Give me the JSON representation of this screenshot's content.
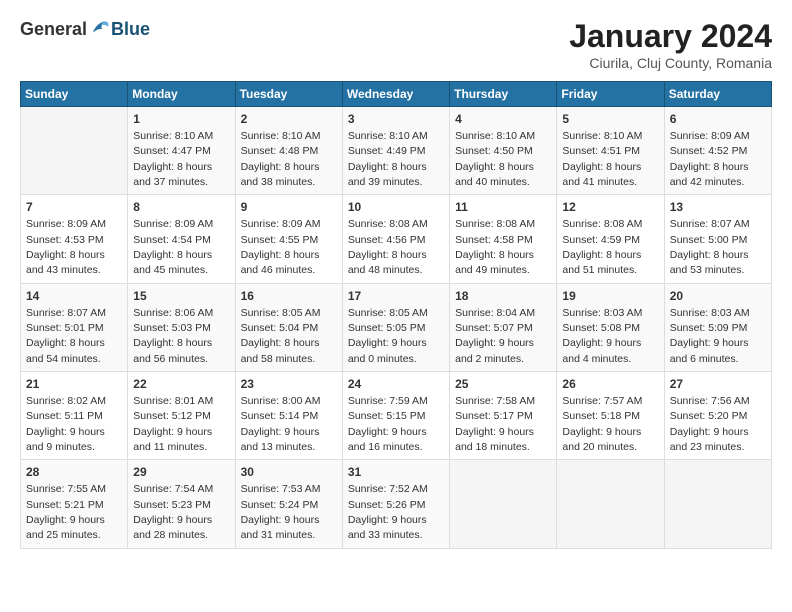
{
  "header": {
    "logo": {
      "general": "General",
      "blue": "Blue"
    },
    "title": "January 2024",
    "subtitle": "Ciurila, Cluj County, Romania"
  },
  "days_of_week": [
    "Sunday",
    "Monday",
    "Tuesday",
    "Wednesday",
    "Thursday",
    "Friday",
    "Saturday"
  ],
  "weeks": [
    [
      {
        "day": "",
        "info": ""
      },
      {
        "day": "1",
        "info": "Sunrise: 8:10 AM\nSunset: 4:47 PM\nDaylight: 8 hours\nand 37 minutes."
      },
      {
        "day": "2",
        "info": "Sunrise: 8:10 AM\nSunset: 4:48 PM\nDaylight: 8 hours\nand 38 minutes."
      },
      {
        "day": "3",
        "info": "Sunrise: 8:10 AM\nSunset: 4:49 PM\nDaylight: 8 hours\nand 39 minutes."
      },
      {
        "day": "4",
        "info": "Sunrise: 8:10 AM\nSunset: 4:50 PM\nDaylight: 8 hours\nand 40 minutes."
      },
      {
        "day": "5",
        "info": "Sunrise: 8:10 AM\nSunset: 4:51 PM\nDaylight: 8 hours\nand 41 minutes."
      },
      {
        "day": "6",
        "info": "Sunrise: 8:09 AM\nSunset: 4:52 PM\nDaylight: 8 hours\nand 42 minutes."
      }
    ],
    [
      {
        "day": "7",
        "info": "Sunrise: 8:09 AM\nSunset: 4:53 PM\nDaylight: 8 hours\nand 43 minutes."
      },
      {
        "day": "8",
        "info": "Sunrise: 8:09 AM\nSunset: 4:54 PM\nDaylight: 8 hours\nand 45 minutes."
      },
      {
        "day": "9",
        "info": "Sunrise: 8:09 AM\nSunset: 4:55 PM\nDaylight: 8 hours\nand 46 minutes."
      },
      {
        "day": "10",
        "info": "Sunrise: 8:08 AM\nSunset: 4:56 PM\nDaylight: 8 hours\nand 48 minutes."
      },
      {
        "day": "11",
        "info": "Sunrise: 8:08 AM\nSunset: 4:58 PM\nDaylight: 8 hours\nand 49 minutes."
      },
      {
        "day": "12",
        "info": "Sunrise: 8:08 AM\nSunset: 4:59 PM\nDaylight: 8 hours\nand 51 minutes."
      },
      {
        "day": "13",
        "info": "Sunrise: 8:07 AM\nSunset: 5:00 PM\nDaylight: 8 hours\nand 53 minutes."
      }
    ],
    [
      {
        "day": "14",
        "info": "Sunrise: 8:07 AM\nSunset: 5:01 PM\nDaylight: 8 hours\nand 54 minutes."
      },
      {
        "day": "15",
        "info": "Sunrise: 8:06 AM\nSunset: 5:03 PM\nDaylight: 8 hours\nand 56 minutes."
      },
      {
        "day": "16",
        "info": "Sunrise: 8:05 AM\nSunset: 5:04 PM\nDaylight: 8 hours\nand 58 minutes."
      },
      {
        "day": "17",
        "info": "Sunrise: 8:05 AM\nSunset: 5:05 PM\nDaylight: 9 hours\nand 0 minutes."
      },
      {
        "day": "18",
        "info": "Sunrise: 8:04 AM\nSunset: 5:07 PM\nDaylight: 9 hours\nand 2 minutes."
      },
      {
        "day": "19",
        "info": "Sunrise: 8:03 AM\nSunset: 5:08 PM\nDaylight: 9 hours\nand 4 minutes."
      },
      {
        "day": "20",
        "info": "Sunrise: 8:03 AM\nSunset: 5:09 PM\nDaylight: 9 hours\nand 6 minutes."
      }
    ],
    [
      {
        "day": "21",
        "info": "Sunrise: 8:02 AM\nSunset: 5:11 PM\nDaylight: 9 hours\nand 9 minutes."
      },
      {
        "day": "22",
        "info": "Sunrise: 8:01 AM\nSunset: 5:12 PM\nDaylight: 9 hours\nand 11 minutes."
      },
      {
        "day": "23",
        "info": "Sunrise: 8:00 AM\nSunset: 5:14 PM\nDaylight: 9 hours\nand 13 minutes."
      },
      {
        "day": "24",
        "info": "Sunrise: 7:59 AM\nSunset: 5:15 PM\nDaylight: 9 hours\nand 16 minutes."
      },
      {
        "day": "25",
        "info": "Sunrise: 7:58 AM\nSunset: 5:17 PM\nDaylight: 9 hours\nand 18 minutes."
      },
      {
        "day": "26",
        "info": "Sunrise: 7:57 AM\nSunset: 5:18 PM\nDaylight: 9 hours\nand 20 minutes."
      },
      {
        "day": "27",
        "info": "Sunrise: 7:56 AM\nSunset: 5:20 PM\nDaylight: 9 hours\nand 23 minutes."
      }
    ],
    [
      {
        "day": "28",
        "info": "Sunrise: 7:55 AM\nSunset: 5:21 PM\nDaylight: 9 hours\nand 25 minutes."
      },
      {
        "day": "29",
        "info": "Sunrise: 7:54 AM\nSunset: 5:23 PM\nDaylight: 9 hours\nand 28 minutes."
      },
      {
        "day": "30",
        "info": "Sunrise: 7:53 AM\nSunset: 5:24 PM\nDaylight: 9 hours\nand 31 minutes."
      },
      {
        "day": "31",
        "info": "Sunrise: 7:52 AM\nSunset: 5:26 PM\nDaylight: 9 hours\nand 33 minutes."
      },
      {
        "day": "",
        "info": ""
      },
      {
        "day": "",
        "info": ""
      },
      {
        "day": "",
        "info": ""
      }
    ]
  ]
}
